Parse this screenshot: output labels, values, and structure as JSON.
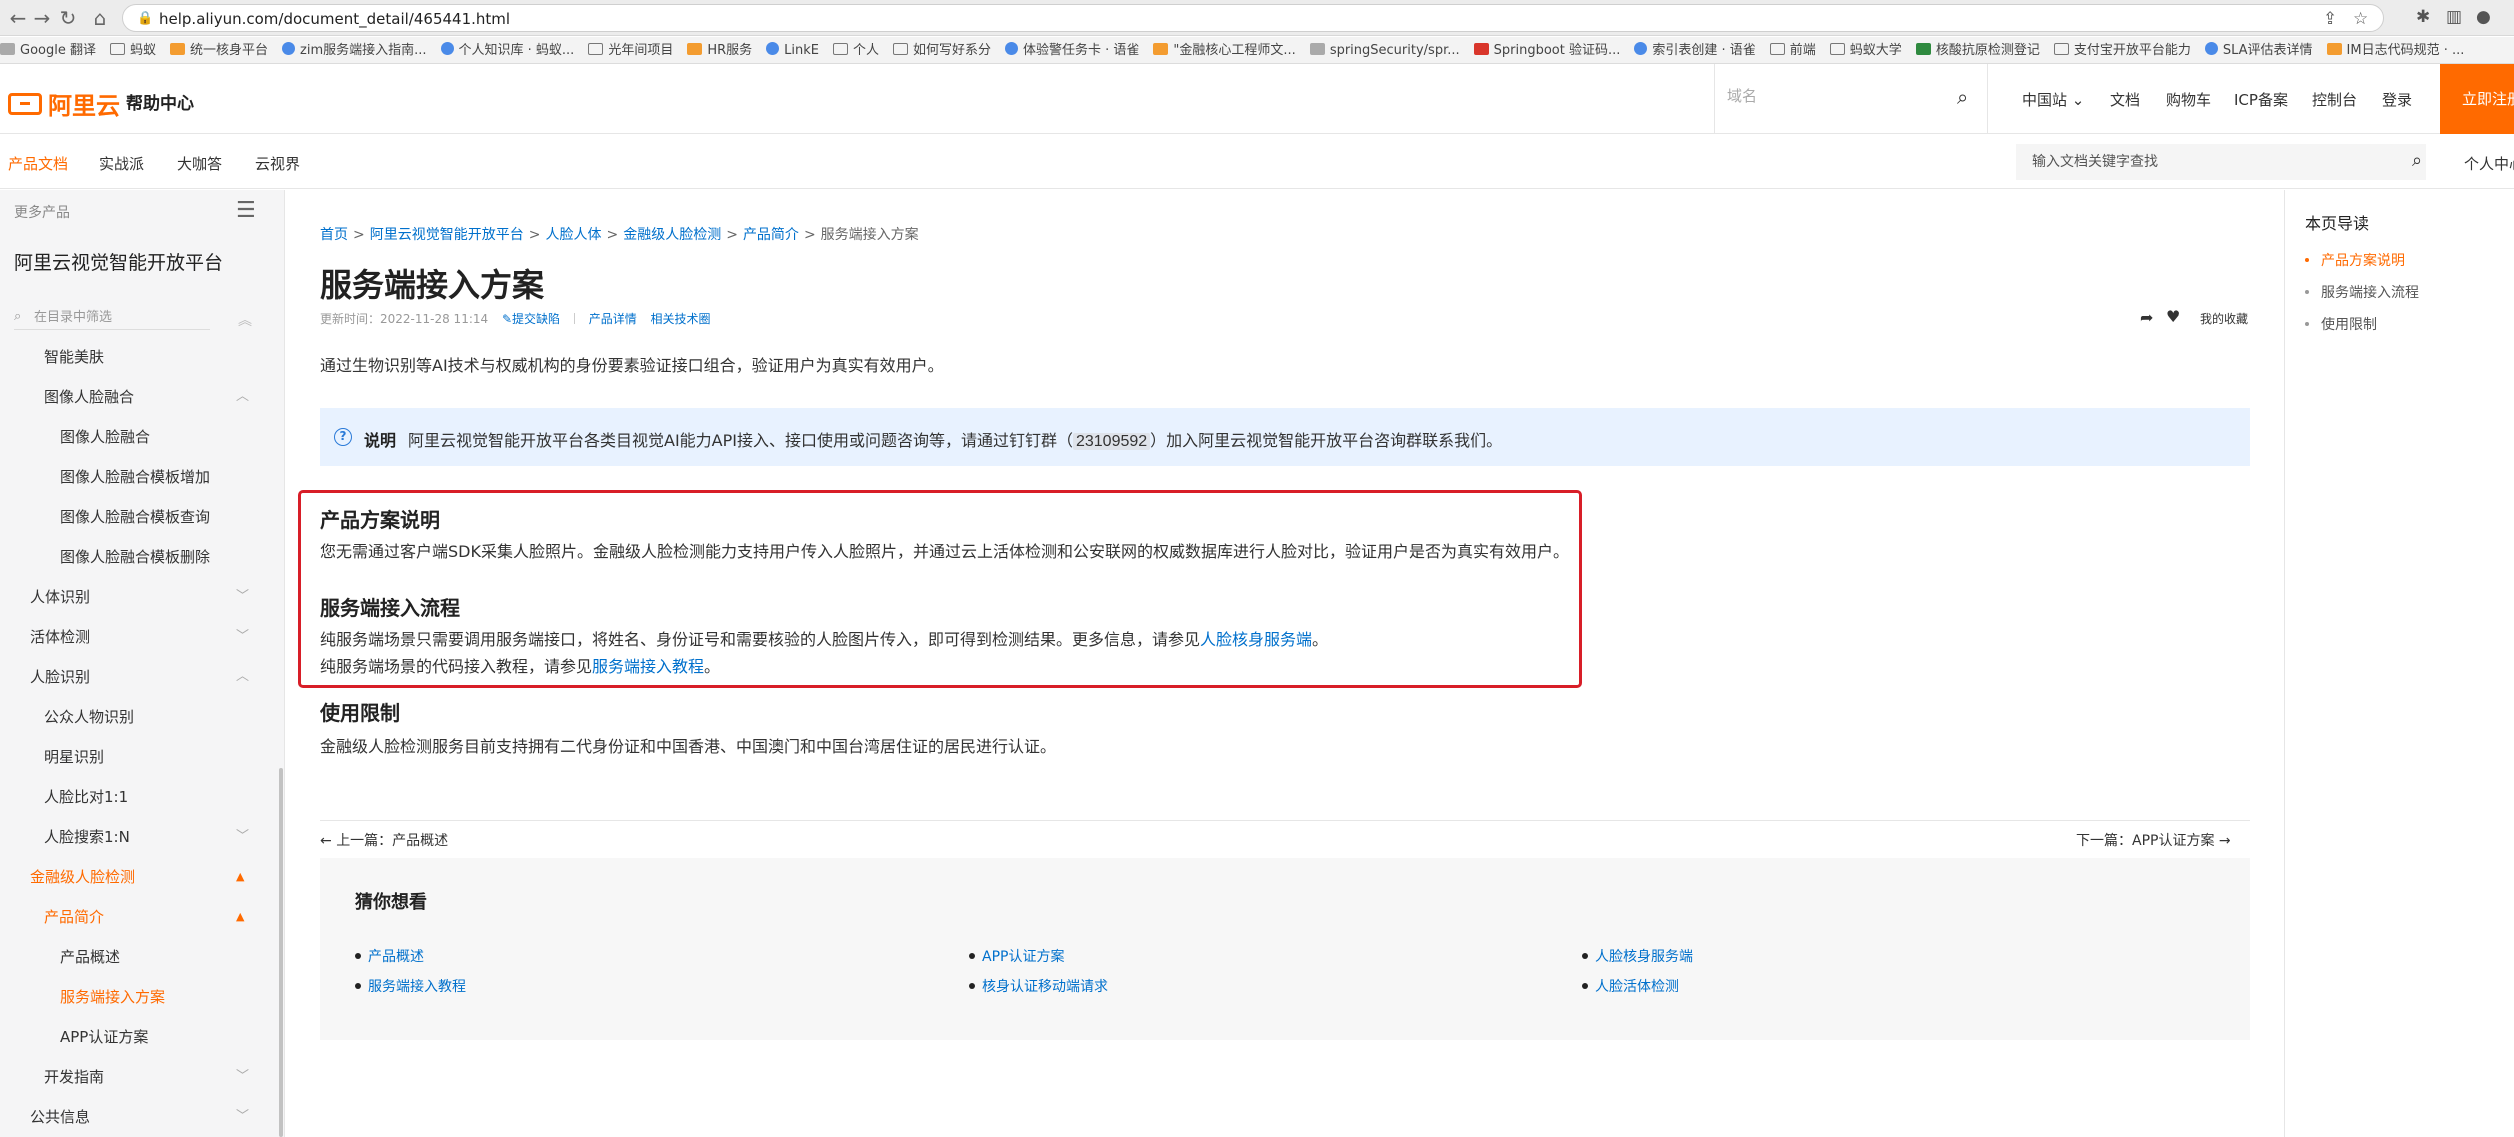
{
  "browser": {
    "url": "help.aliyun.com/document_detail/465441.html",
    "bookmarks": [
      {
        "label": "Google 翻译",
        "icon": "translate-icon"
      },
      {
        "label": "蚂蚁",
        "icon": "folder-icon"
      },
      {
        "label": "统一核身平台",
        "icon": "plus-icon"
      },
      {
        "label": "zim服务端接入指南...",
        "icon": "yuque-icon"
      },
      {
        "label": "个人知识库 · 蚂蚁...",
        "icon": "yuque-icon"
      },
      {
        "label": "光年间项目",
        "icon": "folder-icon"
      },
      {
        "label": "HR服务",
        "icon": "hr-icon"
      },
      {
        "label": "LinkE",
        "icon": "linke-icon"
      },
      {
        "label": "个人",
        "icon": "folder-icon"
      },
      {
        "label": "如何写好系分",
        "icon": "folder-icon"
      },
      {
        "label": "体验警任务卡 · 语雀",
        "icon": "yuque-icon"
      },
      {
        "label": "\"金融核心工程师文...",
        "icon": "plus-icon"
      },
      {
        "label": "springSecurity/spr...",
        "icon": "github-icon"
      },
      {
        "label": "Springboot 验证码...",
        "icon": "csdn-icon"
      },
      {
        "label": "索引表创建 · 语雀",
        "icon": "yuque-icon"
      },
      {
        "label": "前端",
        "icon": "folder-icon"
      },
      {
        "label": "蚂蚁大学",
        "icon": "folder-icon"
      },
      {
        "label": "核酸抗原检测登记",
        "icon": "green-icon"
      },
      {
        "label": "支付宝开放平台能力",
        "icon": "doc-icon"
      },
      {
        "label": "SLA评估表详情",
        "icon": "sla-icon"
      },
      {
        "label": "IM日志代码规范 · ...",
        "icon": "plus-icon"
      }
    ]
  },
  "header": {
    "logo_text": "阿里云",
    "help_center": "帮助中心",
    "domain_placeholder": "域名",
    "links": [
      "中国站",
      "文档",
      "购物车",
      "ICP备案",
      "控制台",
      "登录"
    ],
    "register": "立即注册"
  },
  "subnav": {
    "tabs": [
      "产品文档",
      "实战派",
      "大咖答",
      "云视界"
    ],
    "search_placeholder": "输入文档关键字查找",
    "personal": "个人中心"
  },
  "sidebar": {
    "more_products": "更多产品",
    "product_name": "阿里云视觉智能开放平台",
    "filter_placeholder": "在目录中筛选",
    "items": [
      {
        "label": "智能美肤"
      },
      {
        "label": "图像人脸融合"
      },
      {
        "label": "图像人脸融合"
      },
      {
        "label": "图像人脸融合模板增加"
      },
      {
        "label": "图像人脸融合模板查询"
      },
      {
        "label": "图像人脸融合模板删除"
      },
      {
        "label": "人体识别"
      },
      {
        "label": "活体检测"
      },
      {
        "label": "人脸识别"
      },
      {
        "label": "公众人物识别"
      },
      {
        "label": "明星识别"
      },
      {
        "label": "人脸比对1:1"
      },
      {
        "label": "人脸搜索1:N"
      },
      {
        "label": "金融级人脸检测"
      },
      {
        "label": "产品简介"
      },
      {
        "label": "产品概述"
      },
      {
        "label": "服务端接入方案"
      },
      {
        "label": "APP认证方案"
      },
      {
        "label": "开发指南"
      },
      {
        "label": "公共信息"
      }
    ]
  },
  "main": {
    "breadcrumb": [
      "首页",
      "阿里云视觉智能开放平台",
      "人脸人体",
      "金融级人脸检测",
      "产品简介",
      "服务端接入方案"
    ],
    "title": "服务端接入方案",
    "updated": "更新时间：2022-11-28 11:14",
    "submit_issue": "提交缺陷",
    "product_detail": "产品详情",
    "related_tech": "相关技术圈",
    "favorite": "我的收藏",
    "intro": "通过生物识别等AI技术与权威机构的身份要素验证接口组合，验证用户为真实有效用户。",
    "note": {
      "label": "说明",
      "text_before": "阿里云视觉智能开放平台各类目视觉AI能力API接入、接口使用或问题咨询等，请通过钉钉群（",
      "code": "23109592",
      "text_after": "）加入阿里云视觉智能开放平台咨询群联系我们。"
    },
    "sections": [
      {
        "heading": "产品方案说明",
        "para": "您无需通过客户端SDK采集人脸照片。金融级人脸检测能力支持用户传入人脸照片，并通过云上活体检测和公安联网的权威数据库进行人脸对比，验证用户是否为真实有效用户。"
      },
      {
        "heading": "服务端接入流程",
        "para1_before": "纯服务端场景只需要调用服务端接口，将姓名、身份证号和需要核验的人脸图片传入，即可得到检测结果。更多信息，请参见",
        "para1_link": "人脸核身服务端",
        "para1_after": "。",
        "para2_before": "纯服务端场景的代码接入教程，请参见",
        "para2_link": "服务端接入教程",
        "para2_after": "。"
      },
      {
        "heading": "使用限制",
        "para": "金融级人脸检测服务目前支持拥有二代身份证和中国香港、中国澳门和中国台湾居住证的居民进行认证。"
      }
    ],
    "prev": "上一篇：产品概述",
    "next": "下一篇：APP认证方案",
    "guess": {
      "title": "猜你想看",
      "items": [
        "产品概述",
        "APP认证方案",
        "人脸核身服务端",
        "服务端接入教程",
        "核身认证移动端请求",
        "人脸活体检测"
      ]
    }
  },
  "toc": {
    "title": "本页导读",
    "items": [
      "产品方案说明",
      "服务端接入流程",
      "使用限制"
    ]
  },
  "colors": {
    "brand": "#ff6a00",
    "link": "#0070cc",
    "highlight_border": "#d81e28",
    "note_bg": "#e8f2ff"
  }
}
